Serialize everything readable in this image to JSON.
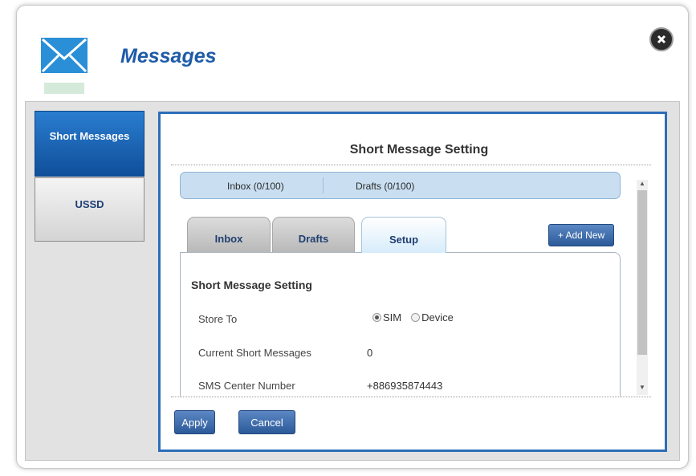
{
  "header": {
    "title": "Messages",
    "icon": "envelope-icon",
    "close_icon": "close-icon"
  },
  "sidebar": {
    "items": [
      {
        "label": "Short Messages",
        "active": true
      },
      {
        "label": "USSD",
        "active": false
      }
    ]
  },
  "main": {
    "title": "Short Message Setting",
    "counts": {
      "inbox": "Inbox (0/100)",
      "drafts": "Drafts (0/100)"
    },
    "tabs": [
      {
        "label": "Inbox",
        "selected": false
      },
      {
        "label": "Drafts",
        "selected": false
      },
      {
        "label": "Setup",
        "selected": true
      }
    ],
    "add_new_label": "+ Add New",
    "section_title": "Short Message Setting",
    "store_to": {
      "label": "Store To",
      "options": [
        "SIM",
        "Device"
      ],
      "selected": "SIM"
    },
    "current_messages": {
      "label": "Current Short Messages",
      "value": "0"
    },
    "sms_center": {
      "label": "SMS Center Number",
      "value": "+886935874443"
    }
  },
  "buttons": {
    "apply_label": "Apply",
    "cancel_label": "Cancel"
  },
  "colors": {
    "accent": "#1e5ba8",
    "active_tab": "#0f4f9a",
    "content_border": "#2d6eb8",
    "button": "#2c5a99"
  }
}
